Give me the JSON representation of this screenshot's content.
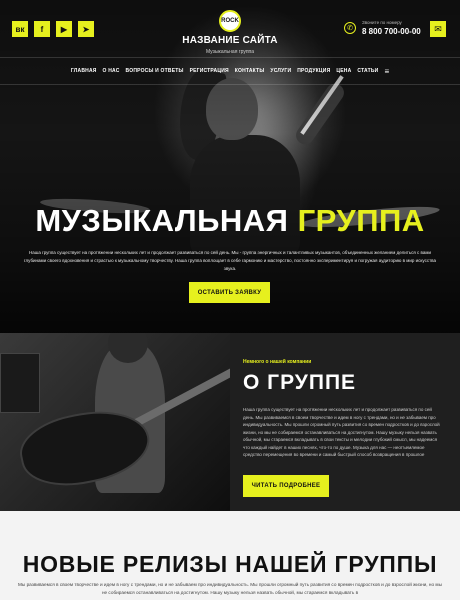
{
  "header": {
    "social": [
      "vk-icon",
      "facebook-icon",
      "youtube-icon",
      "telegram-icon"
    ],
    "social_glyphs": [
      "вк",
      "f",
      "▶",
      "➤"
    ],
    "logo_badge": "ROCK",
    "site_name": "НАЗВАНИЕ САЙТА",
    "site_tagline": "Музыкальная группа",
    "phone_label": "Звоните по номеру",
    "phone": "8 800 700-00-00"
  },
  "nav": {
    "items": [
      "ГЛАВНАЯ",
      "О НАС",
      "ВОПРОСЫ И ОТВЕТЫ",
      "РЕГИСТРАЦИЯ",
      "КОНТАКТЫ",
      "УСЛУГИ",
      "ПРОДУКЦИЯ",
      "ЦЕНА",
      "СТАТЬИ"
    ]
  },
  "hero": {
    "title_main": "МУЗЫКАЛЬНАЯ",
    "title_highlight": "ГРУППА",
    "description": "Наша группа существует на протяжении нескольких лет и продолжает развиваться по сей день. Мы - группа энергичных и талантливых музыкантов, объединенных желанием делиться с вами глубинами своего вдохновения и страстью к музыкальному творчеству. Наша группа воплощает в себе гармонию и мастерство, постоянно экспериментируя и погружая аудиторию в мир искусства звука.",
    "button": "ОСТАВИТЬ ЗАЯВКУ"
  },
  "about": {
    "kicker": "Немного о нашей компании",
    "title": "О ГРУППЕ",
    "text": "Наша группа существует на протяжении нескольких лет и продолжает развиваться по сей день. Мы развиваемся в своем творчестве и идем в ногу с трендами, но и не забываем про индивидуальность. Мы прошли огромный путь развития со времен подростков и до взрослой жизни, но мы не собираемся останавливаться на достигнутом. Нашу музыку нельзя назвать обычной, мы стараемся вкладывать в свои тексты и мелодии глубокий смысл, мы надеемся что каждый найдет в наших песнях, что-то по душе. Музыка для нас — неотъемлемое средство перемещения во времени и самый быстрый способ возвращения в прошлое",
    "button": "ЧИТАТЬ ПОДРОБНЕЕ"
  },
  "releases": {
    "title": "НОВЫЕ РЕЛИЗЫ НАШЕЙ ГРУППЫ",
    "text": "Мы развиваемся в своем творчестве и идем в ногу с трендами, но и не забываем про индивидуальность. Мы прошли огромный путь развития со времен подростков и до взрослой жизни, но мы не собираемся останавливаться на достигнутом. Нашу музыку нельзя назвать обычной, мы стараемся вкладывать в"
  },
  "colors": {
    "accent": "#e6f01e",
    "dark": "#1f1f1f",
    "light": "#f3f3f3"
  }
}
